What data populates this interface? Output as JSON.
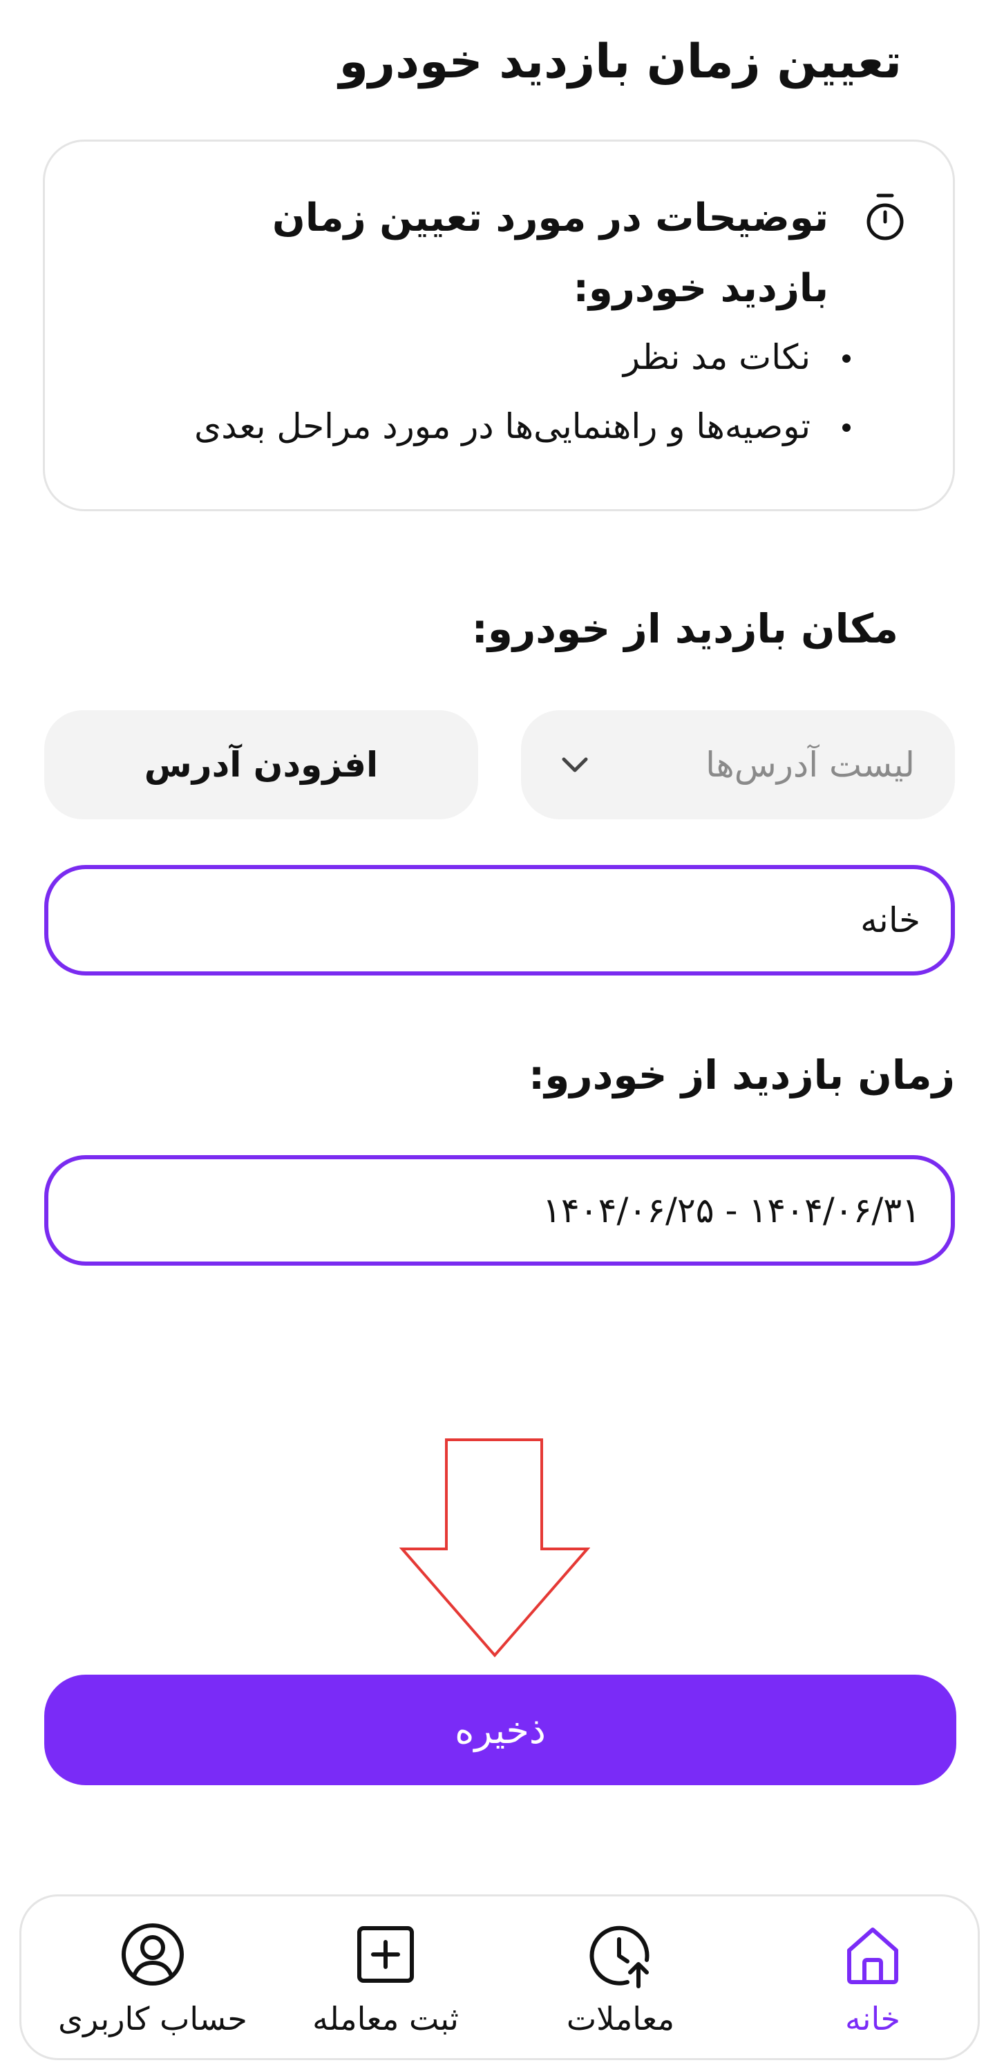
{
  "page": {
    "title": "تعیین زمان بازدید خودرو"
  },
  "info": {
    "title": "توضیحات در مورد تعیین زمان بازدید خودرو:",
    "bullets": [
      "نکات مد نظر",
      "توصیه‌ها و راهنمایی‌ها در مورد مراحل بعدی"
    ],
    "icon": "stopwatch-icon"
  },
  "location": {
    "label": "مکان بازدید از خودرو:",
    "address_select_placeholder": "لیست آدرس‌ها",
    "add_address_label": "افزودن آدرس",
    "selected_value": "خانه"
  },
  "time": {
    "label": "زمان بازدید از خودرو:",
    "range_value": "۱۴۰۴/۰۶/۳۱ - ۱۴۰۴/۰۶/۲۵"
  },
  "actions": {
    "save_label": "ذخیره"
  },
  "annotation": {
    "arrow_color": "#e53935",
    "icon": "down-arrow-icon"
  },
  "nav": {
    "items": [
      {
        "label": "خانه",
        "icon": "home-icon",
        "active": true
      },
      {
        "label": "معاملات",
        "icon": "clock-history-icon",
        "active": false
      },
      {
        "label": "ثبت معامله",
        "icon": "add-square-icon",
        "active": false
      },
      {
        "label": "حساب کاربری",
        "icon": "user-icon",
        "active": false
      }
    ]
  },
  "colors": {
    "accent": "#7a2bf7",
    "field_border": "#7a2bf0",
    "muted_background": "#f3f3f3",
    "card_border": "#e4e4e4"
  }
}
